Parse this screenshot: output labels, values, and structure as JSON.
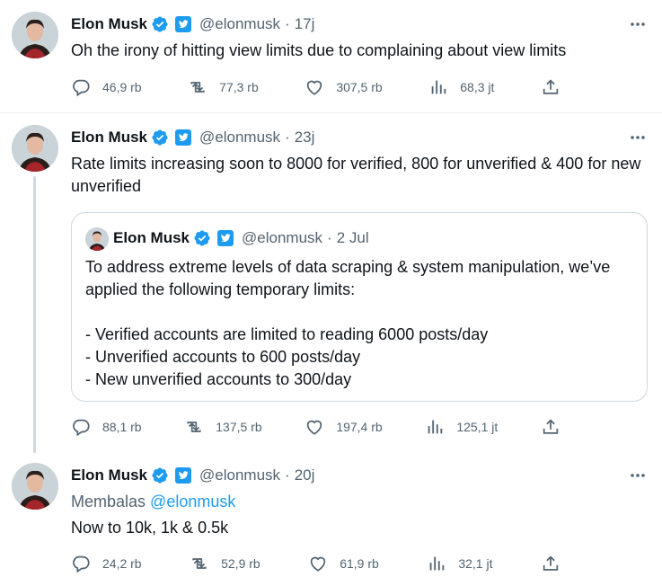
{
  "colors": {
    "accent": "#1d9bf0",
    "muted": "#536471",
    "text": "#0f1419",
    "border": "#cfd9de"
  },
  "tweets": [
    {
      "name": "Elon Musk",
      "handle": "@elonmusk",
      "separator": "·",
      "time": "17j",
      "text": "Oh the irony of hitting view limits due to complaining about view limits",
      "replies": "46,9 rb",
      "retweets": "77,3 rb",
      "likes": "307,5 rb",
      "views": "68,3 jt"
    },
    {
      "name": "Elon Musk",
      "handle": "@elonmusk",
      "separator": "·",
      "time": "23j",
      "text": "Rate limits increasing soon to 8000 for verified, 800 for unverified & 400 for new unverified",
      "quote": {
        "name": "Elon Musk",
        "handle": "@elonmusk",
        "separator": "·",
        "time": "2 Jul",
        "text": "To address extreme levels of data scraping & system manipulation, we’ve applied the following temporary limits:\n\n- Verified accounts are limited to reading 6000 posts/day\n- Unverified accounts to 600 posts/day\n- New unverified accounts to 300/day"
      },
      "replies": "88,1 rb",
      "retweets": "137,5 rb",
      "likes": "197,4 rb",
      "views": "125,1 jt"
    },
    {
      "name": "Elon Musk",
      "handle": "@elonmusk",
      "separator": "·",
      "time": "20j",
      "reply_prefix": "Membalas",
      "reply_handle": "@elonmusk",
      "text": "Now to 10k, 1k & 0.5k",
      "replies": "24,2 rb",
      "retweets": "52,9 rb",
      "likes": "61,9 rb",
      "views": "32,1 jt"
    }
  ]
}
